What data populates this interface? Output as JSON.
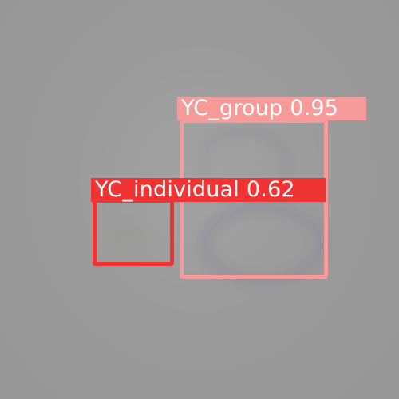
{
  "detections": [
    {
      "class_name": "YC_group",
      "confidence": "0.95",
      "color": "#f79a9a"
    },
    {
      "class_name": "YC_individual",
      "confidence": "0.62",
      "color": "#f03333"
    }
  ]
}
